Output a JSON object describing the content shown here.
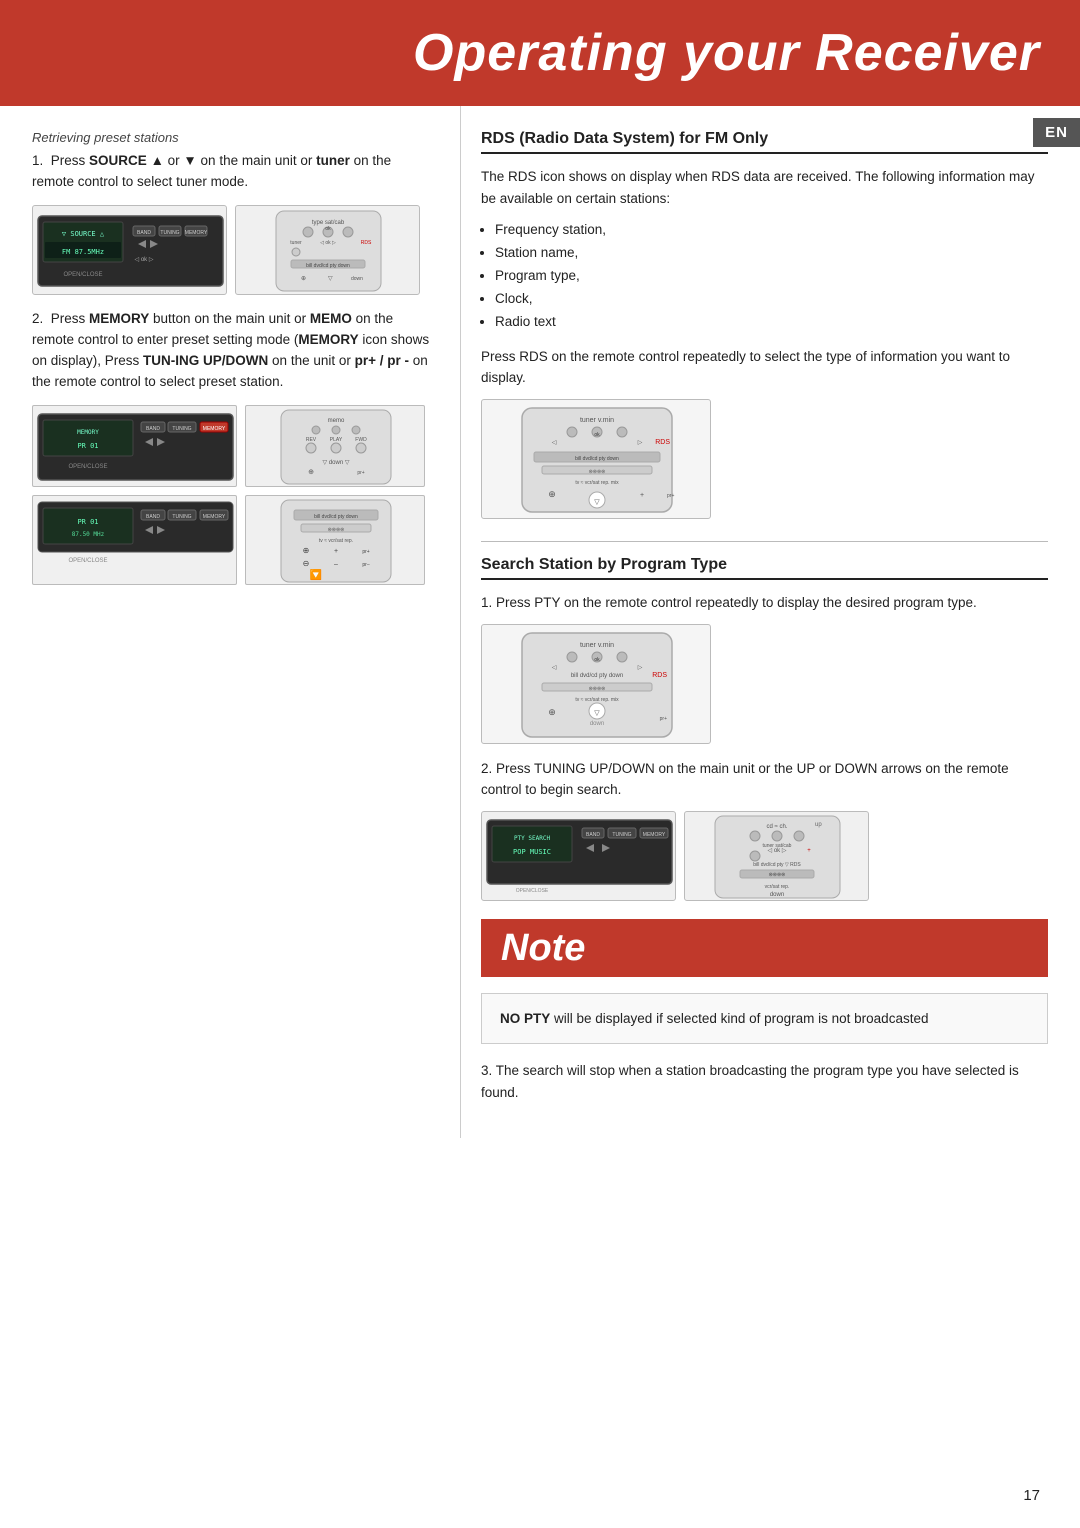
{
  "header": {
    "title": "Operating your Receiver",
    "bg_color": "#c0392b"
  },
  "en_badge": "EN",
  "left_column": {
    "section_label": "Retrieving preset stations",
    "step1": {
      "text_before": "Press ",
      "bold1": "SOURCE",
      "symbol": " ▲ or ▼ ",
      "text_after": " on the main unit or ",
      "bold2": "tuner",
      "text_end": " on the remote control to select tuner mode."
    },
    "step2": {
      "text_before": "Press ",
      "bold1": "MEMORY",
      "text1": " button on the main unit or ",
      "bold2": "MEMO",
      "text2": " on the remote control to enter preset setting mode (",
      "bold3": "MEMORY",
      "text3": " icon shows on display), Press ",
      "bold4": "TUN-ING UP/DOWN",
      "text4": " on the unit or ",
      "bold5": "pr+ / pr -",
      "text5": " on the remote control to select preset station."
    }
  },
  "right_column": {
    "rds_section": {
      "heading": "RDS (Radio Data System) for FM Only",
      "para1": "The RDS icon shows on display when RDS data are received.  The following information may be available on certain stations:",
      "bullets": [
        "Frequency station,",
        "Station name,",
        "Program type,",
        "Clock,",
        "Radio text"
      ],
      "para2": "Press RDS on the remote control repeatedly to select the type of information you want to display."
    },
    "search_section": {
      "heading": "Search Station by Program Type",
      "step1": "1.  Press PTY on the remote control repeatedly to display the desired program type.",
      "step2": "2.  Press TUNING UP/DOWN on the main unit or the UP or DOWN arrows on the remote control to  begin search.",
      "step3": "3.  The search will stop when a station broadcasting the program type you have selected is found."
    },
    "note": {
      "title": "Note",
      "content_bold": "NO PTY",
      "content_text": " will be displayed if selected kind of program is not broadcasted"
    }
  },
  "page_number": "17"
}
